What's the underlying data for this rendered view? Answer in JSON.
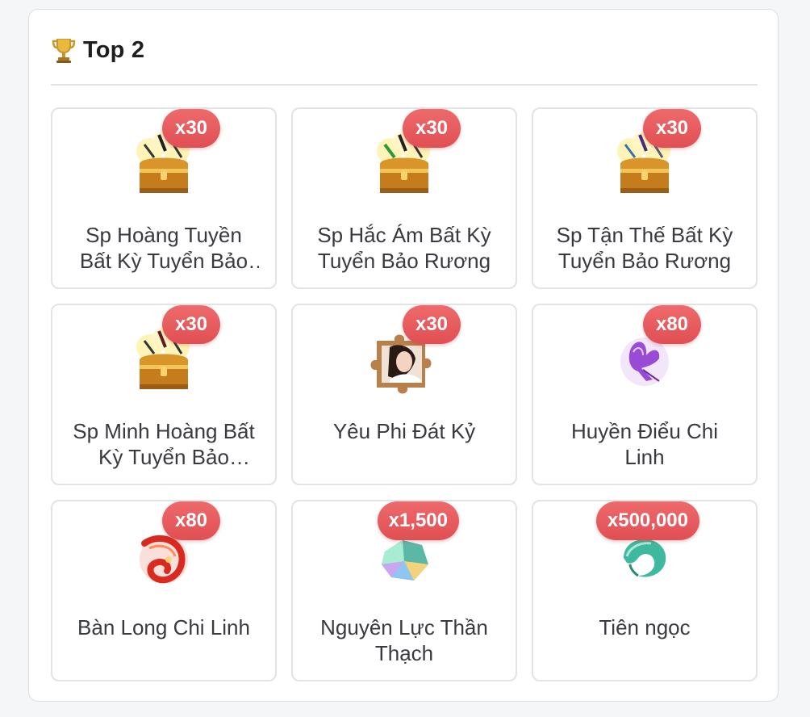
{
  "header": {
    "title": "Top 2",
    "icon": "trophy-icon"
  },
  "colors": {
    "badge": "#e5585c",
    "card_border": "#e2e3e6",
    "text": "#383a3f"
  },
  "rewards": [
    {
      "name": "Sp Hoàng Tuyền Bất Kỳ Tuyển Bảo Rương",
      "quantity": "x30",
      "icon": "treasure-chest-icon"
    },
    {
      "name": "Sp Hắc Ám Bất Kỳ Tuyển Bảo Rương",
      "quantity": "x30",
      "icon": "treasure-chest-icon"
    },
    {
      "name": "Sp Tận Thế Bất Kỳ Tuyển Bảo Rương",
      "quantity": "x30",
      "icon": "treasure-chest-icon"
    },
    {
      "name": "Sp Minh Hoàng Bất Kỳ Tuyển Bảo Rương",
      "quantity": "x30",
      "icon": "treasure-chest-icon"
    },
    {
      "name": "Yêu Phi Đát Kỷ",
      "quantity": "x30",
      "icon": "puzzle-piece-icon"
    },
    {
      "name": "Huyền Điểu Chi Linh",
      "quantity": "x80",
      "icon": "purple-bird-icon"
    },
    {
      "name": "Bàn Long Chi Linh",
      "quantity": "x80",
      "icon": "red-dragon-icon"
    },
    {
      "name": "Nguyên Lực Thần Thạch",
      "quantity": "x1,500",
      "icon": "crystal-icon"
    },
    {
      "name": "Tiên ngọc",
      "quantity": "x500,000",
      "icon": "jade-icon"
    }
  ]
}
